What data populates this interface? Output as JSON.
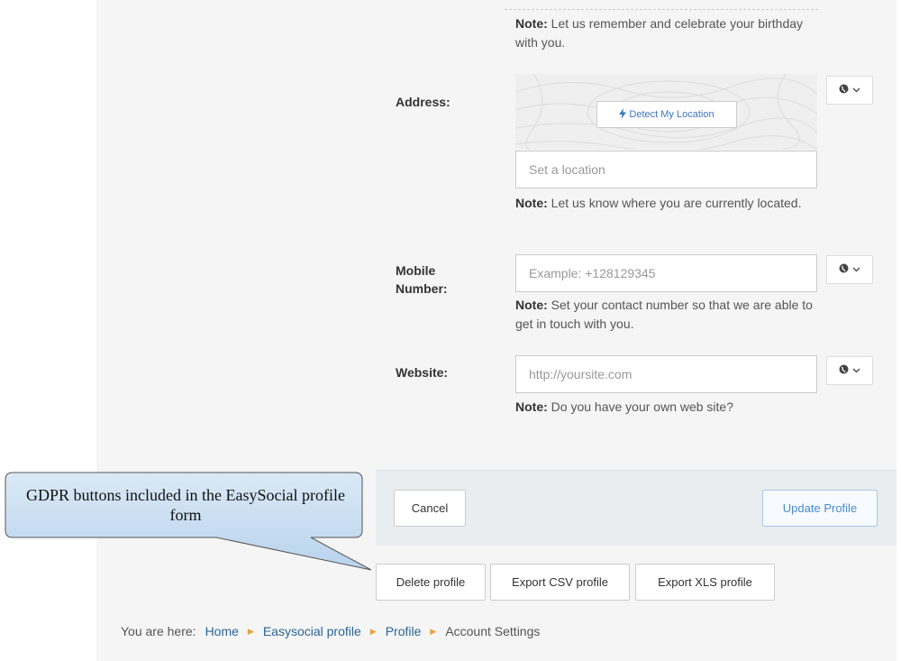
{
  "birthday_note": {
    "bold": "Note:",
    "text": " Let us remember and celebrate your birthday with you."
  },
  "address": {
    "label": "Address:",
    "detect_button": "Detect My Location",
    "placeholder": "Set a location",
    "note_bold": "Note:",
    "note": " Let us know where you are currently located."
  },
  "mobile": {
    "label": "Mobile Number:",
    "placeholder": "Example: +128129345",
    "note_bold": "Note:",
    "note": " Set your contact number so that we are able to get in touch with you."
  },
  "website": {
    "label": "Website:",
    "placeholder": "http://yoursite.com",
    "note_bold": "Note:",
    "note": " Do you have your own web site?"
  },
  "privacy_icon": "globe-icon",
  "actions": {
    "cancel": "Cancel",
    "update": "Update Profile"
  },
  "gdpr": {
    "delete": "Delete profile",
    "export_csv": "Export CSV profile",
    "export_xls": "Export XLS profile"
  },
  "callout": "GDPR buttons included in the EasySocial profile form",
  "breadcrumb": {
    "prefix": "You are here:",
    "items": [
      "Home",
      "Easysocial profile",
      "Profile",
      "Account Settings"
    ]
  },
  "colors": {
    "link": "#2a6496",
    "accent": "#e8a13a",
    "primary": "#4a8acb"
  }
}
